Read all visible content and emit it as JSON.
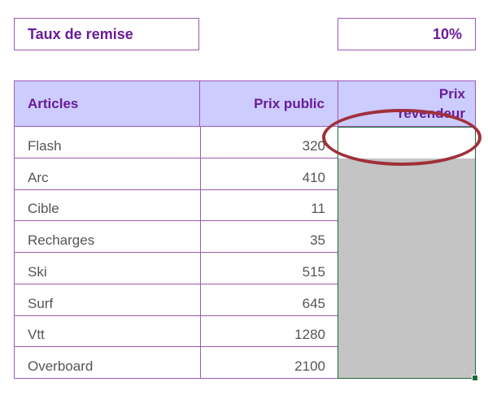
{
  "rate": {
    "label": "Taux de remise",
    "value": "10%"
  },
  "headers": {
    "articles": "Articles",
    "public_price": "Prix public",
    "reseller_price_line1": "Prix",
    "reseller_price_line2": "revendeur"
  },
  "rows": [
    {
      "name": "Flash",
      "price": "320"
    },
    {
      "name": "Arc",
      "price": "410"
    },
    {
      "name": "Cible",
      "price": "11"
    },
    {
      "name": "Recharges",
      "price": "35"
    },
    {
      "name": "Ski",
      "price": "515"
    },
    {
      "name": "Surf",
      "price": "645"
    },
    {
      "name": "Vtt",
      "price": "1280"
    },
    {
      "name": "Overboard",
      "price": "2100"
    }
  ],
  "colors": {
    "accent": "#6a1b9a",
    "header_bg": "#ccccff",
    "selection_border": "#1e6b3a",
    "selection_fill": "#c4c4c4",
    "annotation": "#a0303a"
  }
}
